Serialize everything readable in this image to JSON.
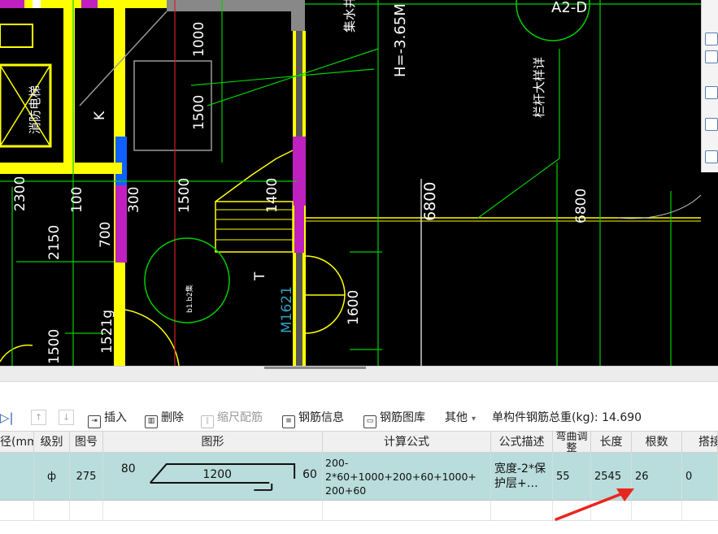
{
  "cad": {
    "dim_texts": [
      "1000",
      "1500",
      "2300",
      "100",
      "300",
      "1500",
      "1400",
      "2150",
      "700",
      "1521g",
      "1500",
      "1600"
    ],
    "label_K": "K",
    "label_T": "T",
    "label_stair": "消防电梯",
    "label_sump": "集水井",
    "label_height": "H=-3.65M",
    "label_axis": "A2-D",
    "label_detail": "栏杆大样详",
    "label_circle": "b1.b2集",
    "label_door": "M1621",
    "elev_left": "6800",
    "elev_right": "6800",
    "colors": {
      "background": "#000000",
      "yellow": "#ffff00",
      "green": "#00d000",
      "magenta": "#c020c0",
      "blue": "#1060ff",
      "white": "#ffffff"
    }
  },
  "toolbar": {
    "insert": "插入",
    "delete": "删除",
    "scale_rebar": "缩尺配筋",
    "rebar_info": "钢筋信息",
    "rebar_library": "钢筋图库",
    "other": "其他",
    "total_label": "单构件钢筋总重(kg): 14.690"
  },
  "table": {
    "headers": [
      "径(mm)",
      "级别",
      "图号",
      "图形",
      "计算公式",
      "公式描述",
      "弯曲调整",
      "长度",
      "根数",
      "搭接"
    ],
    "row": {
      "grade_symbol": "ф",
      "shape_no": "275",
      "shape_left": "80",
      "shape_mid": "1200",
      "shape_right": "60",
      "formula_line1": "200-2*60+1000+200+60+1000+",
      "formula_line2": "200+60",
      "desc_line1": "宽度-2*保",
      "desc_line2": "护层+…",
      "bend_adjust": "55",
      "length": "2545",
      "count": "26",
      "lap": "0"
    }
  }
}
